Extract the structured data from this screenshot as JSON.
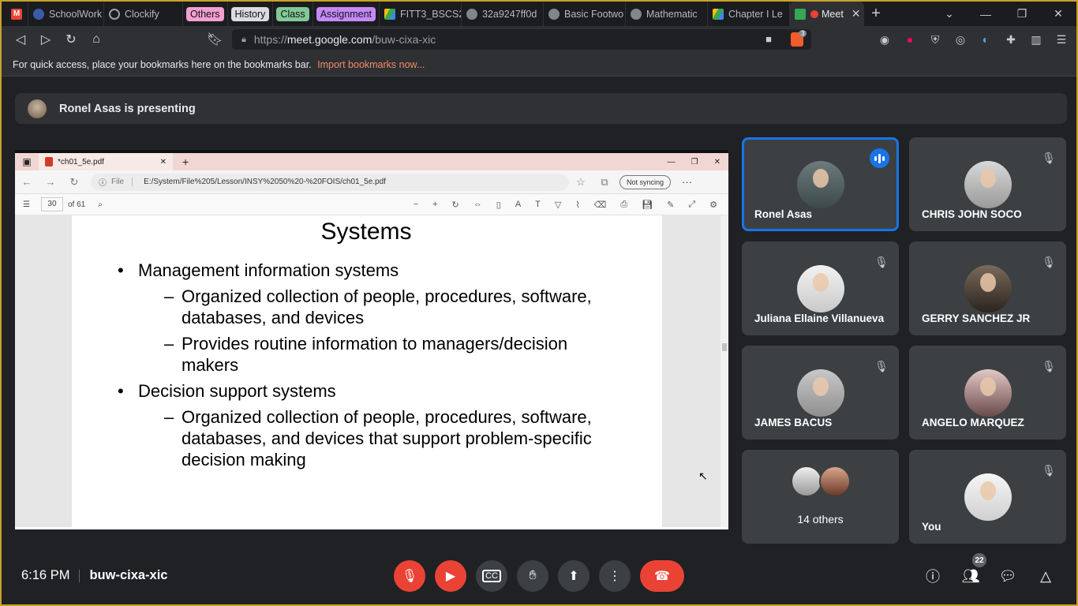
{
  "browser": {
    "tabs": [
      {
        "label": "",
        "icon": "gmail-icon",
        "color": "#ea4335"
      },
      {
        "label": "SchoolWork",
        "icon": "schoolwork-icon",
        "color": "#5f6368"
      },
      {
        "label": "Clockify",
        "icon": "clockify-icon",
        "color": "#5f6368"
      }
    ],
    "tab_groups": [
      {
        "label": "Others",
        "color": "#f29fd0"
      },
      {
        "label": "History",
        "color": "#dadce0"
      },
      {
        "label": "Class",
        "color": "#81c995"
      },
      {
        "label": "Assignment",
        "color": "#c58af9"
      }
    ],
    "tabs_right": [
      {
        "label": "FITT3_BSCS2",
        "icon": "drive-icon"
      },
      {
        "label": "32a9247ff0d",
        "icon": "globe-icon"
      },
      {
        "label": "Basic Footwo",
        "icon": "globe-icon"
      },
      {
        "label": "Mathematic",
        "icon": "globe-icon"
      },
      {
        "label": "Chapter I Le",
        "icon": "drive-icon"
      }
    ],
    "active_tab": "Meet",
    "url_scheme": "https://",
    "url_host": "meet.google.com",
    "url_path": "/buw-cixa-xic",
    "brave_badge": "3",
    "bookmarks_text": "For quick access, place your bookmarks here on the bookmarks bar.",
    "bookmarks_link": "Import bookmarks now..."
  },
  "meet": {
    "presenting_text": "Ronel Asas is presenting",
    "time": "6:16 PM",
    "meeting_code": "buw-cixa-xic",
    "people_count": "22",
    "participants": [
      {
        "name": "Ronel Asas",
        "speaking": true
      },
      {
        "name": "CHRIS JOHN SOCO"
      },
      {
        "name": "Juliana Ellaine Villanueva"
      },
      {
        "name": "GERRY SANCHEZ JR"
      },
      {
        "name": "JAMES BACUS"
      },
      {
        "name": "ANGELO MARQUEZ"
      },
      {
        "name": "14 others"
      },
      {
        "name": "You"
      }
    ]
  },
  "shared_screen": {
    "pdf_tab": "*ch01_5e.pdf",
    "address_label": "File",
    "address": "E:/System/File%205/Lesson/INSY%2050%20-%20FOIS/ch01_5e.pdf",
    "sync": "Not syncing",
    "page": "30",
    "of_pages": "of 61",
    "slide": {
      "title": "Systems",
      "bullets": [
        "Management information systems",
        "Organized collection of people, procedures, software, databases, and devices",
        "Provides routine information to managers/decision makers",
        "Decision support systems",
        "Organized collection of people, procedures, software, databases, and devices that support problem-specific decision making"
      ]
    }
  }
}
